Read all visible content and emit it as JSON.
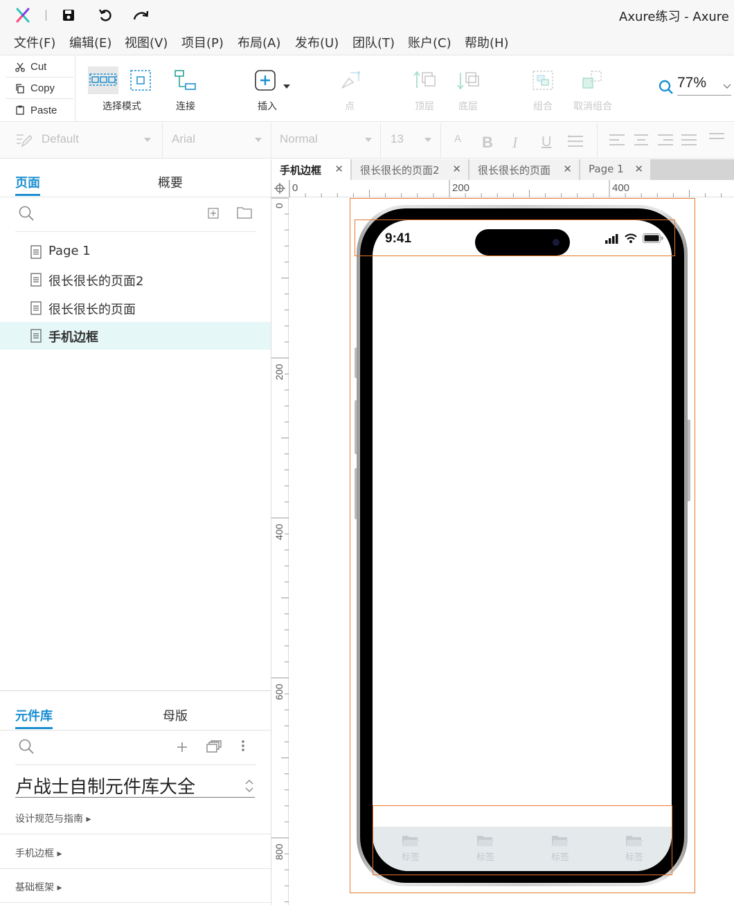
{
  "window": {
    "title": "Axure练习 - Axure R"
  },
  "menu": [
    "文件(F)",
    "编辑(E)",
    "视图(V)",
    "项目(P)",
    "布局(A)",
    "发布(U)",
    "团队(T)",
    "账户(C)",
    "帮助(H)"
  ],
  "clipboard": {
    "cut": "Cut",
    "copy": "Copy",
    "paste": "Paste"
  },
  "toolbar": {
    "select_mode": "选择模式",
    "connect": "连接",
    "insert": "插入",
    "point": "点",
    "top_layer": "顶层",
    "bottom_layer": "底层",
    "group": "组合",
    "ungroup": "取消组合",
    "zoom": "77%"
  },
  "format": {
    "style": "Default",
    "font": "Arial",
    "weight": "Normal",
    "size": "13"
  },
  "pages_panel": {
    "tab_pages": "页面",
    "tab_outline": "概要",
    "pages": [
      "Page 1",
      "很长很长的页面2",
      "很长很长的页面",
      "手机边框"
    ],
    "selected_index": 3
  },
  "library_panel": {
    "tab_library": "元件库",
    "tab_masters": "母版",
    "library_name": "卢战士自制元件库大全",
    "categories": [
      "设计规范与指南 ▸",
      "手机边框 ▸",
      "基础框架 ▸"
    ]
  },
  "doc_tabs": [
    "手机边框",
    "很长很长的页面2",
    "很长很长的页面",
    "Page 1"
  ],
  "rulers": {
    "h": [
      "0",
      "200",
      "400"
    ],
    "v": [
      "0",
      "200",
      "400",
      "600",
      "800"
    ]
  },
  "phone": {
    "time": "9:41",
    "tabbar_labels": [
      "标签",
      "标签",
      "标签",
      "标签"
    ]
  },
  "colors": {
    "accent": "#1a8fd1",
    "selection": "#e8772c",
    "selected_row": "#e6f7f7"
  }
}
